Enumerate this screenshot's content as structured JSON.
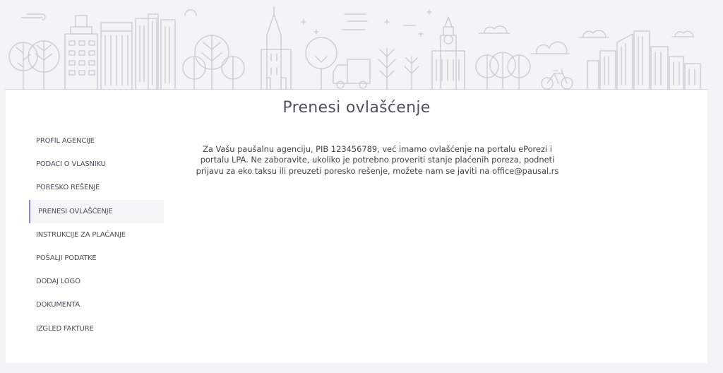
{
  "page": {
    "title": "Prenesi ovlašćenje"
  },
  "sidebar": {
    "items": [
      {
        "label": "PROFIL AGENCIJE",
        "name": "sidebar-item-profil-agencije"
      },
      {
        "label": "PODACI O VLASNIKU",
        "name": "sidebar-item-podaci-o-vlasniku"
      },
      {
        "label": "PORESKO REŠENJE",
        "name": "sidebar-item-poresko-resenje"
      },
      {
        "label": "PRENESI OVLAŠĆENJE",
        "name": "sidebar-item-prenesi-ovlascenje"
      },
      {
        "label": "INSTRUKCIJE ZA PLAĆANJE",
        "name": "sidebar-item-instrukcije-za-placanje"
      },
      {
        "label": "POŠALJI PODATKE",
        "name": "sidebar-item-posalji-podatke"
      },
      {
        "label": "DODAJ LOGO",
        "name": "sidebar-item-dodaj-logo"
      },
      {
        "label": "DOKUMENTA",
        "name": "sidebar-item-dokumenta"
      },
      {
        "label": "IZGLED FAKTURE",
        "name": "sidebar-item-izgled-fakture"
      }
    ],
    "active_index": 3
  },
  "content": {
    "message": "Za Vašu paušalnu agenciju, PIB 123456789, već imamo ovlašćenje na portalu ePorezi i portalu LPA. Ne zaboravite, ukoliko je potrebno proveriti stanje plaćenih poreza, podneti prijavu za eko taksu ili preuzeti poresko rešenje, možete nam se javiti na office@pausal.rs"
  },
  "colors": {
    "background": "#f3f4f5",
    "card": "#ffffff",
    "illustration_stroke": "#c6ccd2",
    "active_accent": "#8d84d6",
    "text": "#444444"
  }
}
